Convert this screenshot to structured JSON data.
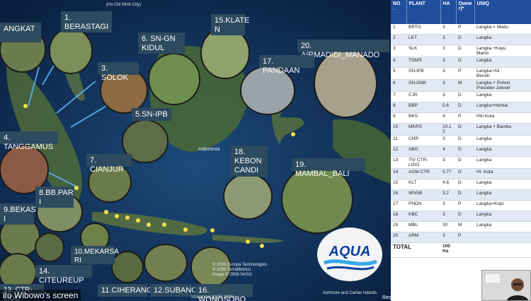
{
  "presenter": {
    "label": "ito Wibowo's screen"
  },
  "slide": {
    "coords_header": "(Ho Chi Minh City)",
    "map_places": {
      "indonesia": "Indonesia"
    },
    "labels": [
      {
        "id": "l0",
        "text": "ANGKAT"
      },
      {
        "id": "l1",
        "text": "1.\nBERASTAGI"
      },
      {
        "id": "l6",
        "text": "6. SN-GN\nKIDUL"
      },
      {
        "id": "l15",
        "text": "15.KLATE\nN"
      },
      {
        "id": "l20",
        "text": "20. AIRMADIDI_MANADO"
      },
      {
        "id": "l3",
        "text": "3. SOLOK"
      },
      {
        "id": "l17",
        "text": "17. PANDAAN"
      },
      {
        "id": "l5",
        "text": "5.SN-IPB"
      },
      {
        "id": "l4",
        "text": "4. TANGGAMUS"
      },
      {
        "id": "l7",
        "text": "7. CIANJUR"
      },
      {
        "id": "l18",
        "text": "18.\nKEBON\nCANDI"
      },
      {
        "id": "l19",
        "text": "19. MAMBAL_BALI"
      },
      {
        "id": "l8",
        "text": "8.BB.PAR\nI"
      },
      {
        "id": "l9",
        "text": "9.BEKAS\nI"
      },
      {
        "id": "l10",
        "text": "10.MEKARSA\nRI"
      },
      {
        "id": "l14",
        "text": "14. CITEUREUP"
      },
      {
        "id": "l13",
        "text": "13. CTR-LIDO"
      },
      {
        "id": "l11",
        "text": "11.CIHERANG"
      },
      {
        "id": "l12",
        "text": "12.SUBANG"
      },
      {
        "id": "l16",
        "text": "16. WONOSOBO"
      }
    ],
    "credit": "© 2006 Europa Technologies\n© 2006 TerraMetrics\nImage © 2006 NASA",
    "islands_label": "Ashmore and Cartier Islands",
    "status_text": "Streaming |||||||||| 100%",
    "mini_note": "Res"
  },
  "brand": {
    "name": "AQUA",
    "color": "#0d3f9a"
  },
  "table": {
    "headers": [
      "NO\n.",
      "PLANT",
      "HA",
      "Owne\nr)*",
      "UNIQ"
    ],
    "rows": [
      [
        "1",
        "BRTG",
        "3",
        "P",
        "Langka + Madu"
      ],
      [
        "2",
        "LKT",
        "3",
        "D",
        "Langka"
      ],
      [
        "3",
        "SLK",
        "3",
        "D",
        "Langka +Kayu\nManis"
      ],
      [
        "4",
        "TGMS",
        "3",
        "D",
        "Langka"
      ],
      [
        "5",
        "SN-IPB",
        "3",
        "P",
        "Langka+Air\nBersih"
      ],
      [
        "6",
        "SN-GNK",
        "3",
        "M",
        "Langka + Pohon\nPresiden Jokowi"
      ],
      [
        "7",
        "CJR",
        "3",
        "D",
        "Langka"
      ],
      [
        "8",
        "BBP",
        "5.6",
        "D",
        "Langka+Herbal"
      ],
      [
        "9",
        "BKS",
        "4",
        "P",
        "Htn Kota"
      ],
      [
        "10",
        "MKRS",
        "10.1\n2",
        "D",
        "Langka + Bambu"
      ],
      [
        "11",
        "CHR",
        "3",
        "D",
        "Langka"
      ],
      [
        "12",
        "SBG",
        "4",
        "D",
        "Langka"
      ],
      [
        "13",
        "TIV CTR-\nLIDO",
        "3",
        "D",
        "Langka"
      ],
      [
        "14",
        "AGM CTR",
        "0.77",
        "D",
        "Ht. Kota"
      ],
      [
        "15",
        "KLT",
        "4.6",
        "D",
        "Langka"
      ],
      [
        "16",
        "WNSB",
        "3.2",
        "D",
        "Langka"
      ],
      [
        "17",
        "PNDN",
        "3",
        "P",
        "Langka+Kopi"
      ],
      [
        "18",
        "KBC",
        "3",
        "D",
        "Langka"
      ],
      [
        "19",
        "MBL",
        "30",
        "M",
        "Langka"
      ],
      [
        "20",
        "ARM",
        "3",
        "P",
        ""
      ]
    ],
    "total_label": "TOTAL",
    "total_ha": "100\nHa"
  }
}
